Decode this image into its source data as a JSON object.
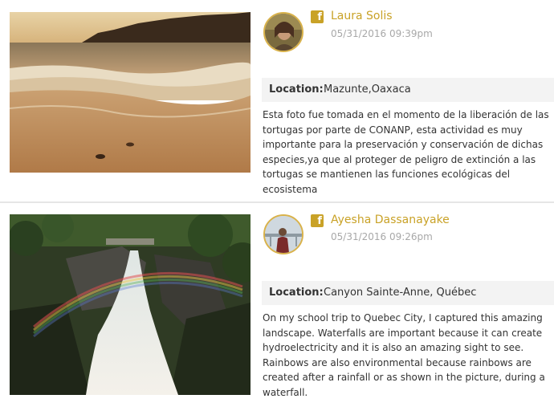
{
  "posts": [
    {
      "author": "Laura Solis",
      "timestamp": "05/31/2016 09:39pm",
      "location_label": "Location:",
      "location": "Mazunte,Oaxaca",
      "description": "Esta foto fue tomada en el momento de la liberación de las tortugas por parte de CONANP, esta actividad es muy importante para la preservación y conservación de dichas especies,ya que al proteger de peligro de extinción a las tortugas se mantienen las funciones ecológicas del ecosistema",
      "social_icon": "facebook-icon",
      "photo": "beach-sunset-photo"
    },
    {
      "author": "Ayesha Dassanayake",
      "timestamp": "05/31/2016 09:26pm",
      "location_label": "Location:",
      "location": "Canyon Sainte-Anne, Québec",
      "description": "On my school trip to Quebec City, I captured this amazing landscape. Waterfalls are important because it can create hydroelectricity and it is also an amazing sight to see. Rainbows are also environmental because rainbows are created after a rainfall or as shown in the picture, during a waterfall.",
      "social_icon": "facebook-icon",
      "photo": "waterfall-rainbow-photo"
    }
  ],
  "colors": {
    "accent": "#c9a227",
    "timestamp": "#a8a8a8",
    "location_bg": "#f3f3f3",
    "divider": "#e6e6e6"
  }
}
